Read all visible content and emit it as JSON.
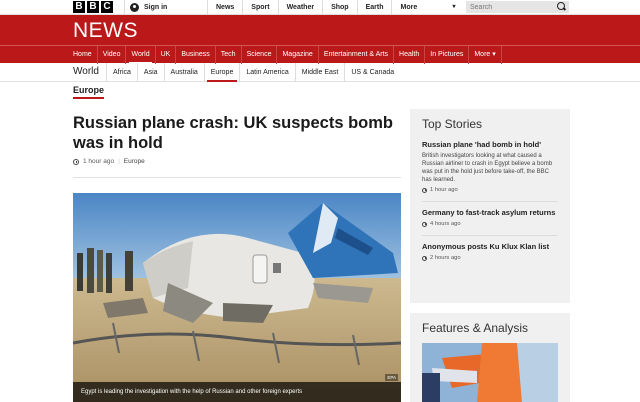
{
  "global_nav": {
    "logo_letters": [
      "B",
      "B",
      "C"
    ],
    "signin_label": "Sign in",
    "items": [
      "News",
      "Sport",
      "Weather",
      "Shop",
      "Earth"
    ],
    "more_label": "More",
    "search_placeholder": "Search"
  },
  "masthead": {
    "title": "NEWS",
    "brand_color": "#bb1919"
  },
  "news_nav": {
    "items": [
      "Home",
      "Video",
      "World",
      "UK",
      "Business",
      "Tech",
      "Science",
      "Magazine",
      "Entertainment & Arts",
      "Health",
      "In Pictures",
      "More ▾"
    ],
    "active": "World"
  },
  "world_nav": {
    "title": "World",
    "items": [
      "Africa",
      "Asia",
      "Australia",
      "Europe",
      "Latin America",
      "Middle East",
      "US & Canada"
    ],
    "active": "Europe"
  },
  "section_label": "Europe",
  "article": {
    "headline": "Russian plane crash: UK suspects bomb was in hold",
    "timestamp": "1 hour ago",
    "tag": "Europe",
    "image_caption": "Egypt is leading the investigation with the help of Russian and other foreign experts",
    "image_credit": "EPA"
  },
  "top_stories": {
    "title": "Top Stories",
    "stories": [
      {
        "title": "Russian plane 'had bomb in hold'",
        "summary": "British investigators looking at what caused a Russian airliner to crash in Egypt believe a bomb was put in the hold just before take-off, the BBC has learned.",
        "time": "1 hour ago"
      },
      {
        "title": "Germany to fast-track asylum returns",
        "time": "4 hours ago"
      },
      {
        "title": "Anonymous posts Ku Klux Klan list",
        "time": "2 hours ago"
      }
    ]
  },
  "features": {
    "title": "Features & Analysis"
  }
}
